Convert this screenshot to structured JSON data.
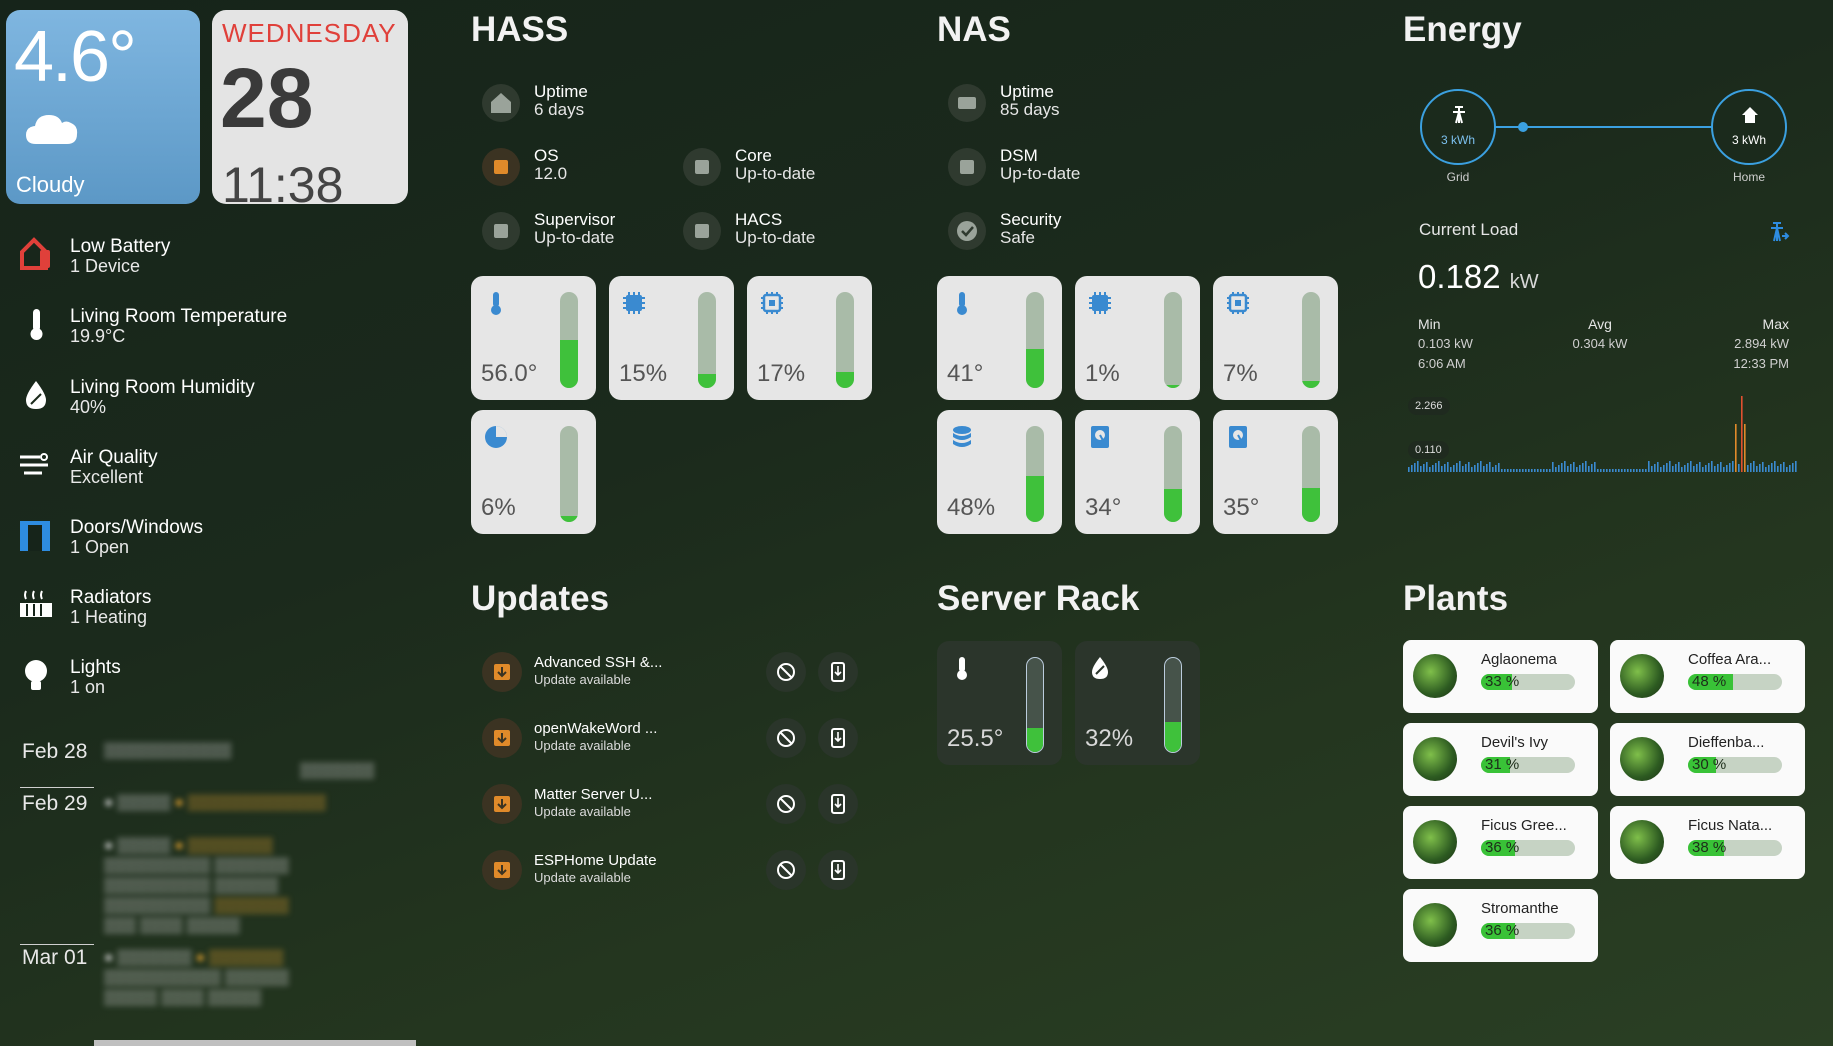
{
  "weather": {
    "temp": "4.6°",
    "condition": "Cloudy"
  },
  "date_card": {
    "weekday": "WEDNESDAY",
    "day": "28",
    "time": "11:38"
  },
  "sidebar": {
    "items": [
      {
        "title": "Low Battery",
        "sub": "1 Device",
        "icon": "battery-alert-icon",
        "color": "#e0403a"
      },
      {
        "title": "Living Room Temperature",
        "sub": "19.9°C",
        "icon": "thermometer-icon"
      },
      {
        "title": "Living Room Humidity",
        "sub": "40%",
        "icon": "humidity-icon"
      },
      {
        "title": "Air Quality",
        "sub": "Excellent",
        "icon": "air-quality-icon"
      },
      {
        "title": "Doors/Windows",
        "sub": "1 Open",
        "icon": "door-open-icon",
        "color": "#2e8ce0"
      },
      {
        "title": "Radiators",
        "sub": "1 Heating",
        "icon": "radiator-icon"
      },
      {
        "title": "Lights",
        "sub": "1 on",
        "icon": "lightbulb-icon"
      }
    ]
  },
  "calendar": {
    "dates": [
      "Feb 28",
      "Feb 29",
      "Mar 01"
    ]
  },
  "hass": {
    "title": "HASS",
    "rows": [
      {
        "label": "Uptime",
        "value": "6 days",
        "icon": "home-assistant-icon"
      },
      {
        "label": "OS",
        "value": "12.0",
        "icon": "package-icon"
      },
      {
        "label": "Core",
        "value": "Up-to-date",
        "icon": "package-icon"
      },
      {
        "label": "Supervisor",
        "value": "Up-to-date",
        "icon": "package-icon"
      },
      {
        "label": "HACS",
        "value": "Up-to-date",
        "icon": "package-icon"
      }
    ],
    "tiles": [
      {
        "value": "56.0°",
        "level": 0.5,
        "icon": "thermometer-icon"
      },
      {
        "value": "15%",
        "level": 0.15,
        "icon": "cpu-64-icon"
      },
      {
        "value": "17%",
        "level": 0.17,
        "icon": "chip-icon"
      },
      {
        "value": "6%",
        "level": 0.06,
        "icon": "pie-chart-icon"
      }
    ]
  },
  "nas": {
    "title": "NAS",
    "rows": [
      {
        "label": "Uptime",
        "value": "85 days",
        "icon": "nas-icon"
      },
      {
        "label": "DSM",
        "value": "Up-to-date",
        "icon": "package-icon"
      },
      {
        "label": "Security",
        "value": "Safe",
        "icon": "check-circle-icon"
      }
    ],
    "tiles": [
      {
        "value": "41°",
        "level": 0.41,
        "icon": "thermometer-icon"
      },
      {
        "value": "1%",
        "level": 0.01,
        "icon": "cpu-64-icon"
      },
      {
        "value": "7%",
        "level": 0.07,
        "icon": "chip-icon"
      },
      {
        "value": "48%",
        "level": 0.48,
        "icon": "database-icon"
      },
      {
        "value": "34°",
        "level": 0.34,
        "icon": "harddisk-icon"
      },
      {
        "value": "35°",
        "level": 0.35,
        "icon": "harddisk-icon"
      }
    ]
  },
  "energy": {
    "title": "Energy",
    "grid": {
      "value": "3 kWh",
      "label": "Grid"
    },
    "home": {
      "value": "3 kWh",
      "label": "Home"
    },
    "current_load_label": "Current Load",
    "current_value": "0.182",
    "current_unit": "kW",
    "min": {
      "label": "Min",
      "value": "0.103 kW",
      "time": "6:06 AM"
    },
    "avg": {
      "label": "Avg",
      "value": "0.304 kW"
    },
    "max": {
      "label": "Max",
      "value": "2.894 kW",
      "time": "12:33 PM"
    },
    "chart_labels": [
      "2.266",
      "0.110"
    ]
  },
  "updates": {
    "title": "Updates",
    "items": [
      {
        "name": "Advanced SSH &...",
        "status": "Update available"
      },
      {
        "name": "openWakeWord ...",
        "status": "Update available"
      },
      {
        "name": "Matter Server U...",
        "status": "Update available"
      },
      {
        "name": "ESPHome Update",
        "status": "Update available"
      }
    ]
  },
  "server_rack": {
    "title": "Server Rack",
    "tiles": [
      {
        "value": "25.5°",
        "level": 0.26,
        "icon": "thermometer-icon"
      },
      {
        "value": "32%",
        "level": 0.32,
        "icon": "humidity-icon"
      }
    ]
  },
  "plants": {
    "title": "Plants",
    "items": [
      {
        "name": "Aglaonema",
        "value": "33 %",
        "level": 0.33
      },
      {
        "name": "Coffea Ara...",
        "value": "48 %",
        "level": 0.48
      },
      {
        "name": "Devil's Ivy",
        "value": "31 %",
        "level": 0.31
      },
      {
        "name": "Dieffenba...",
        "value": "30 %",
        "level": 0.3
      },
      {
        "name": "Ficus Gree...",
        "value": "36 %",
        "level": 0.36
      },
      {
        "name": "Ficus Nata...",
        "value": "38 %",
        "level": 0.38
      },
      {
        "name": "Stromanthe",
        "value": "36 %",
        "level": 0.36
      }
    ]
  }
}
